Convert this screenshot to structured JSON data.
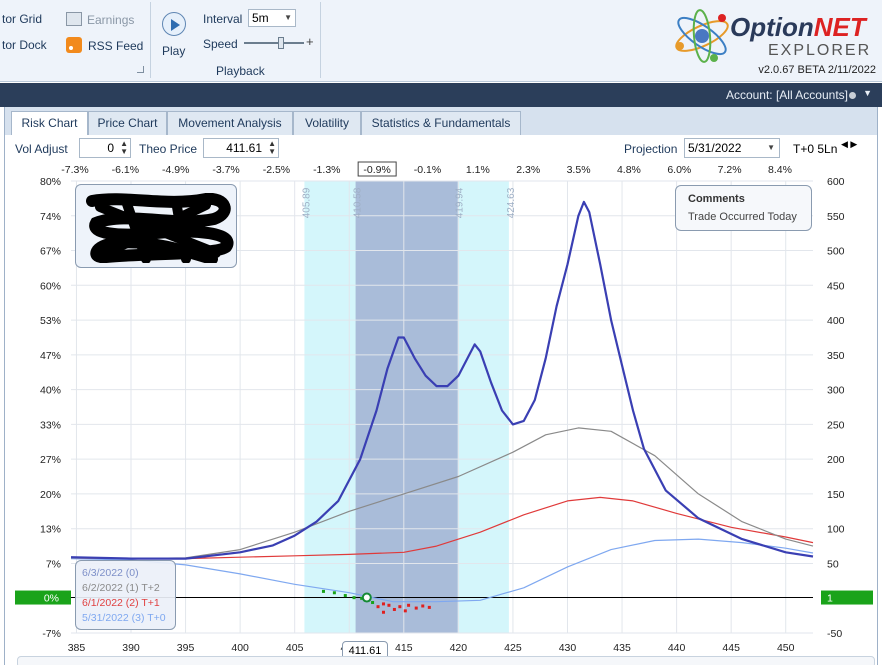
{
  "ribbon": {
    "monitor_grid_label": "tor Grid",
    "earnings_label": "Earnings",
    "monitor_dock_label": "tor Dock",
    "rss_feed_label": "RSS Feed",
    "play_label": "Play",
    "interval_label": "Interval",
    "interval_value": "5m",
    "speed_label": "Speed",
    "group_label": "Playback"
  },
  "logo": {
    "brand_main": "Option",
    "brand_accent": "NET",
    "brand_sub": "EXPLORER",
    "version": "v2.0.67 BETA 2/11/2022"
  },
  "account": {
    "label": "Account: [All Accounts]"
  },
  "tabs": [
    {
      "label": "Risk Chart",
      "active": true
    },
    {
      "label": "Price Chart"
    },
    {
      "label": "Movement Analysis"
    },
    {
      "label": "Volatility"
    },
    {
      "label": "Statistics & Fundamentals"
    }
  ],
  "controls": {
    "vol_adjust_label": "Vol Adjust",
    "vol_adjust_value": "0",
    "theo_price_label": "Theo Price",
    "theo_price_value": "411.61",
    "projection_label": "Projection",
    "projection_date": "5/31/2022",
    "tplus": "T+0",
    "lines_label": "5Ln"
  },
  "comments": {
    "title": "Comments",
    "text": "Trade Occurred Today"
  },
  "legend": [
    {
      "label": "6/3/2022 (0)",
      "color": "#7d8fc8"
    },
    {
      "label": "6/2/2022 (1) T+2",
      "color": "#8a8a8a"
    },
    {
      "label": "6/1/2022 (2) T+1",
      "color": "#e04040"
    },
    {
      "label": "5/31/2022 (3) T+0",
      "color": "#7fa8f0"
    }
  ],
  "current_price_tag": "411.61",
  "chart_data": {
    "type": "line",
    "x_ticks": [
      "385",
      "390",
      "395",
      "400",
      "405",
      "410",
      "415",
      "420",
      "425",
      "430",
      "435",
      "440",
      "445",
      "450"
    ],
    "top_pct_ticks": [
      "-7.3%",
      "-6.1%",
      "-4.9%",
      "-3.7%",
      "-2.5%",
      "-1.3%",
      "-0.9%",
      "-0.1%",
      "1.1%",
      "2.3%",
      "3.5%",
      "4.8%",
      "6.0%",
      "7.2%",
      "8.4%"
    ],
    "left_axis_ticks": [
      "80%",
      "74%",
      "67%",
      "60%",
      "53%",
      "47%",
      "40%",
      "33%",
      "27%",
      "20%",
      "13%",
      "7%",
      "0%",
      "-7%"
    ],
    "right_axis_ticks": [
      "600",
      "550",
      "500",
      "450",
      "400",
      "350",
      "300",
      "250",
      "200",
      "150",
      "100",
      "50",
      "1",
      "-50"
    ],
    "left_zero_label": "0%",
    "right_zero_label": "1",
    "xlim": [
      384.5,
      452.5
    ],
    "ylim": [
      -50,
      600
    ],
    "std_dev_labels": [
      "405.89",
      "410.58",
      "419.94",
      "424.63"
    ],
    "bands": [
      {
        "from": 405.89,
        "to": 424.63,
        "color": "#d4f6fb"
      },
      {
        "from": 410.58,
        "to": 419.94,
        "color": "#a9bcd9"
      }
    ],
    "series": [
      {
        "name": "6/3/2022 (0)",
        "color": "#3a3fb3",
        "width": 2.2,
        "points": [
          [
            384.5,
            59
          ],
          [
            390,
            57
          ],
          [
            395,
            57
          ],
          [
            400,
            66
          ],
          [
            403,
            76
          ],
          [
            405,
            90
          ],
          [
            407,
            110
          ],
          [
            409,
            140
          ],
          [
            411,
            200
          ],
          [
            412.5,
            270
          ],
          [
            413.5,
            330
          ],
          [
            414.5,
            375
          ],
          [
            415,
            375
          ],
          [
            416,
            345
          ],
          [
            417,
            320
          ],
          [
            418,
            305
          ],
          [
            419,
            305
          ],
          [
            420,
            320
          ],
          [
            421,
            350
          ],
          [
            421.5,
            365
          ],
          [
            422,
            355
          ],
          [
            423,
            310
          ],
          [
            424,
            270
          ],
          [
            425,
            250
          ],
          [
            426,
            255
          ],
          [
            427,
            285
          ],
          [
            428,
            345
          ],
          [
            429,
            420
          ],
          [
            430,
            480
          ],
          [
            431,
            550
          ],
          [
            431.5,
            570
          ],
          [
            432,
            555
          ],
          [
            433,
            480
          ],
          [
            434,
            400
          ],
          [
            435,
            335
          ],
          [
            436,
            270
          ],
          [
            437,
            215
          ],
          [
            439,
            155
          ],
          [
            442,
            115
          ],
          [
            446,
            85
          ],
          [
            450,
            66
          ],
          [
            452.5,
            60
          ]
        ]
      },
      {
        "name": "6/2/2022 (1) T+2",
        "color": "#8a8a8a",
        "width": 1.2,
        "points": [
          [
            384.5,
            58
          ],
          [
            390,
            57
          ],
          [
            395,
            58
          ],
          [
            400,
            70
          ],
          [
            405,
            95
          ],
          [
            410,
            125
          ],
          [
            415,
            150
          ],
          [
            420,
            175
          ],
          [
            425,
            210
          ],
          [
            428,
            235
          ],
          [
            431,
            245
          ],
          [
            434,
            240
          ],
          [
            438,
            205
          ],
          [
            442,
            150
          ],
          [
            446,
            110
          ],
          [
            450,
            85
          ],
          [
            452.5,
            75
          ]
        ]
      },
      {
        "name": "6/1/2022 (2) T+1",
        "color": "#e03a3a",
        "width": 1.2,
        "points": [
          [
            384.5,
            58
          ],
          [
            390,
            57
          ],
          [
            395,
            57
          ],
          [
            400,
            59
          ],
          [
            405,
            61
          ],
          [
            410,
            63
          ],
          [
            415,
            66
          ],
          [
            418,
            75
          ],
          [
            422,
            95
          ],
          [
            426,
            120
          ],
          [
            430,
            140
          ],
          [
            433,
            145
          ],
          [
            436,
            140
          ],
          [
            440,
            122
          ],
          [
            445,
            102
          ],
          [
            450,
            88
          ],
          [
            452.5,
            80
          ]
        ]
      },
      {
        "name": "5/31/2022 (3) T+0",
        "color": "#7fa8f0",
        "width": 1.2,
        "points": [
          [
            384.5,
            57
          ],
          [
            390,
            55
          ],
          [
            395,
            48
          ],
          [
            400,
            35
          ],
          [
            405,
            20
          ],
          [
            410,
            8
          ],
          [
            414,
            -5
          ],
          [
            418,
            -5
          ],
          [
            422,
            -3
          ],
          [
            426,
            15
          ],
          [
            430,
            45
          ],
          [
            434,
            70
          ],
          [
            438,
            83
          ],
          [
            442,
            85
          ],
          [
            446,
            80
          ],
          [
            450,
            72
          ],
          [
            452.5,
            65
          ]
        ]
      }
    ],
    "trade_marker": {
      "x": 411.61,
      "y": 1
    }
  }
}
